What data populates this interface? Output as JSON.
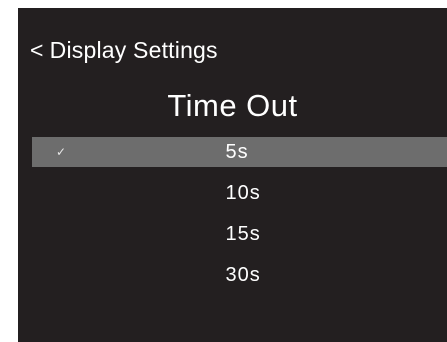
{
  "header": {
    "back_icon": "<",
    "label": "Display Settings"
  },
  "title": "Time Out",
  "options": [
    {
      "label": "5s",
      "selected": true
    },
    {
      "label": "10s",
      "selected": false
    },
    {
      "label": "15s",
      "selected": false
    },
    {
      "label": "30s",
      "selected": false
    }
  ],
  "icons": {
    "check": "✓"
  },
  "colors": {
    "background": "#231f20",
    "highlight": "#6d6d6d",
    "text": "#ffffff"
  }
}
